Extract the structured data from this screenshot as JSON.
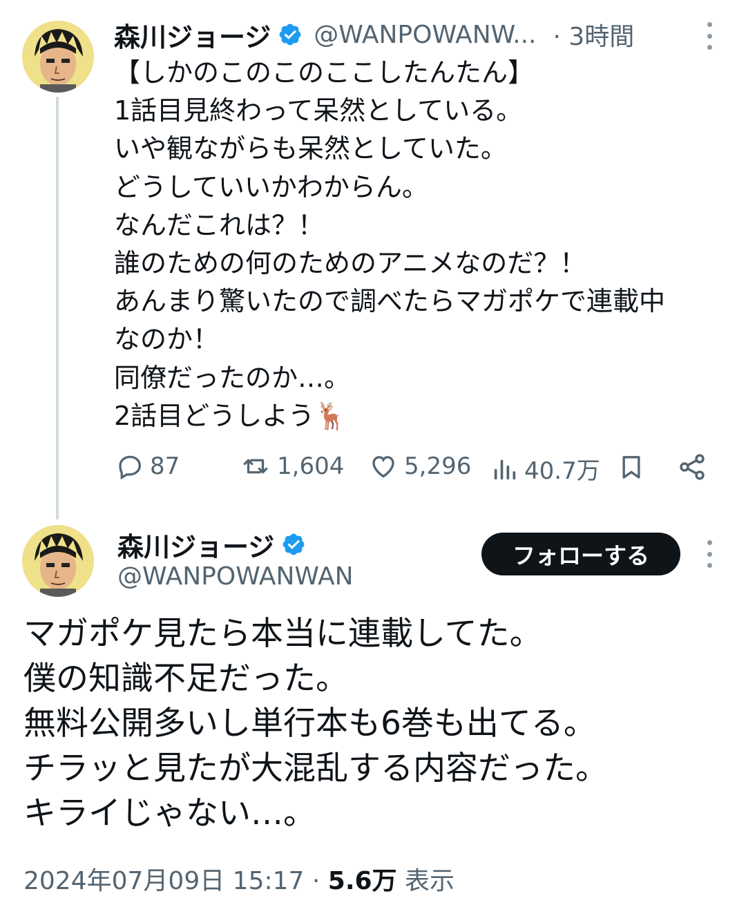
{
  "tweet1": {
    "author_name": "森川ジョージ",
    "handle": "@WANPOWANW...",
    "time": "· 3時間",
    "lines": [
      "【しかのこのこのここしたんたん】",
      "1話目見終わって呆然としている。",
      "いや観ながらも呆然としていた。",
      "どうしていいかわからん。",
      "なんだこれは？！",
      "誰のための何のためのアニメなのだ？！",
      "あんまり驚いたので調べたらマガポケで連載中",
      "なのか！",
      "同僚だったのか…。",
      "2話目どうしよう🦌"
    ],
    "actions": {
      "replies": "87",
      "retweets": "1,604",
      "likes": "5,296",
      "views": "40.7万"
    }
  },
  "tweet2": {
    "author_name": "森川ジョージ",
    "handle": "@WANPOWANWAN",
    "follow_label": "フォローする",
    "lines": [
      "マガポケ見たら本当に連載してた。",
      "僕の知識不足だった。",
      "無料公開多いし単行本も6巻も出てる。",
      "チラッと見たが大混乱する内容だった。",
      "キライじゃない…。"
    ],
    "timestamp": "2024年07月09日 15:17 ·",
    "views_count": "5.6万",
    "views_label": "表示"
  },
  "colors": {
    "verified_blue": "#1d9bf0",
    "secondary_text": "#536471",
    "follow_button_bg": "#0f1419"
  },
  "icons": [
    "verified-badge-icon",
    "more-icon",
    "reply-icon",
    "retweet-icon",
    "like-icon",
    "views-icon",
    "bookmark-icon",
    "share-icon",
    "deer-emoji-icon"
  ]
}
